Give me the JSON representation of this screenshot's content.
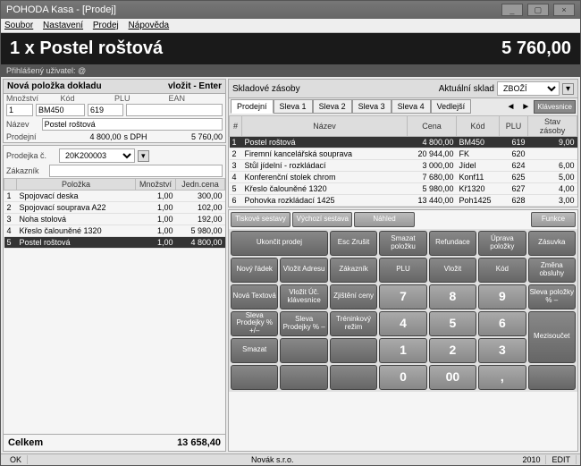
{
  "window": {
    "title": "POHODA Kasa - [Prodej]"
  },
  "menu": {
    "m1": "Soubor",
    "m2": "Nastavení",
    "m3": "Prodej",
    "m4": "Nápověda"
  },
  "banner": {
    "product": "1 x  Postel roštová",
    "price": "5 760,00"
  },
  "userbar": "Přihlášený uživatel: @",
  "new_item": {
    "title": "Nová položka dokladu",
    "hint": "vložit - Enter",
    "lbl_mnozstvi": "Množství",
    "lbl_kod": "Kód",
    "lbl_plu": "PLU",
    "lbl_ean": "EAN",
    "val_mnozstvi": "1",
    "val_kod": "BM450",
    "val_plu": "619",
    "val_ean": "",
    "lbl_nazev": "Název",
    "val_nazev": "Postel roštová",
    "lbl_prodejni": "Prodejní",
    "val_prodejni": "4 800,00",
    "lbl_sdph": "s DPH",
    "val_sdph": "5 760,00"
  },
  "receipt": {
    "lbl_prodejka": "Prodejka č.",
    "val_prodejka": "20K200003",
    "lbl_zakaznik": "Zákazník",
    "val_zakaznik": "",
    "col_polozka": "Položka",
    "col_mnozstvi": "Množství",
    "col_jedncena": "Jedn.cena",
    "lines": [
      {
        "n": "1",
        "name": "Spojovací deska",
        "qty": "1,00",
        "price": "300,00"
      },
      {
        "n": "2",
        "name": "Spojovací souprava A22",
        "qty": "1,00",
        "price": "102,00"
      },
      {
        "n": "3",
        "name": "Noha stolová",
        "qty": "1,00",
        "price": "192,00"
      },
      {
        "n": "4",
        "name": "Křeslo čalouněné 1320",
        "qty": "1,00",
        "price": "5 980,00"
      },
      {
        "n": "5",
        "name": "Postel roštová",
        "qty": "1,00",
        "price": "4 800,00"
      }
    ],
    "lbl_total": "Celkem",
    "val_total": "13 658,40"
  },
  "stock": {
    "title": "Skladové zásoby",
    "lbl_aktualni": "Aktuální sklad",
    "val_aktualni": "ZBOŽÍ",
    "kbd_btn": "Klávesnice",
    "tabs": [
      "Prodejní",
      "Sleva 1",
      "Sleva 2",
      "Sleva 3",
      "Sleva 4",
      "Vedlejší"
    ],
    "cols": {
      "hash": "#",
      "nazev": "Název",
      "cena": "Cena",
      "kod": "Kód",
      "plu": "PLU",
      "stav": "Stav zásoby"
    },
    "rows": [
      {
        "n": "1",
        "name": "Postel roštová",
        "cena": "4 800,00",
        "kod": "BM450",
        "plu": "619",
        "stav": "9,00"
      },
      {
        "n": "2",
        "name": "Firemní kancelářská souprava",
        "cena": "20 944,00",
        "kod": "FK",
        "plu": "620",
        "stav": ""
      },
      {
        "n": "3",
        "name": "Stůl jídelní - rozkládací",
        "cena": "3 000,00",
        "kod": "Jídel",
        "plu": "624",
        "stav": "6,00"
      },
      {
        "n": "4",
        "name": "Konferenční stolek chrom",
        "cena": "7 680,00",
        "kod": "Konf11",
        "plu": "625",
        "stav": "5,00"
      },
      {
        "n": "5",
        "name": "Křeslo čalouněné 1320",
        "cena": "5 980,00",
        "kod": "Kř1320",
        "plu": "627",
        "stav": "4,00"
      },
      {
        "n": "6",
        "name": "Pohovka rozkládací 1425",
        "cena": "13 440,00",
        "kod": "Poh1425",
        "plu": "628",
        "stav": "3,00"
      }
    ]
  },
  "actions": {
    "row1": [
      "Tiskové sestavy",
      "Výchozí sestava",
      "Náhled"
    ],
    "funkce": "Funkce",
    "row2": [
      "Ukončit prodej",
      "Esc Zrušit",
      "Smazat položku",
      "Refundace",
      "Úprava položky",
      "Zásuvka"
    ],
    "row3l": [
      "Nový řádek",
      "Vložit Adresu",
      "Zákazník"
    ],
    "row3r": [
      "PLU",
      "Vložit",
      "Kód",
      "Změna obsluhy"
    ],
    "row4l": [
      "Nová Textová",
      "Vložit Úč. klávesnice",
      "Zjištění ceny"
    ],
    "row4r": [
      "Sleva položky %  –"
    ],
    "row5l": [
      "Sleva Prodejky % +/–",
      "Sleva Prodejky % –",
      "Tréninkový režim"
    ],
    "row5r": [
      "Mezisoučet"
    ],
    "row6l": [
      "Smazat"
    ],
    "keypad": {
      "k7": "7",
      "k8": "8",
      "k9": "9",
      "k4": "4",
      "k5": "5",
      "k6": "6",
      "k1": "1",
      "k2": "2",
      "k3": "3",
      "k0": "0",
      "k00": "00",
      "kdot": ","
    }
  },
  "status": {
    "ok": "OK",
    "company": "Novák  s.r.o.",
    "year": "2010",
    "edit": "EDIT"
  }
}
